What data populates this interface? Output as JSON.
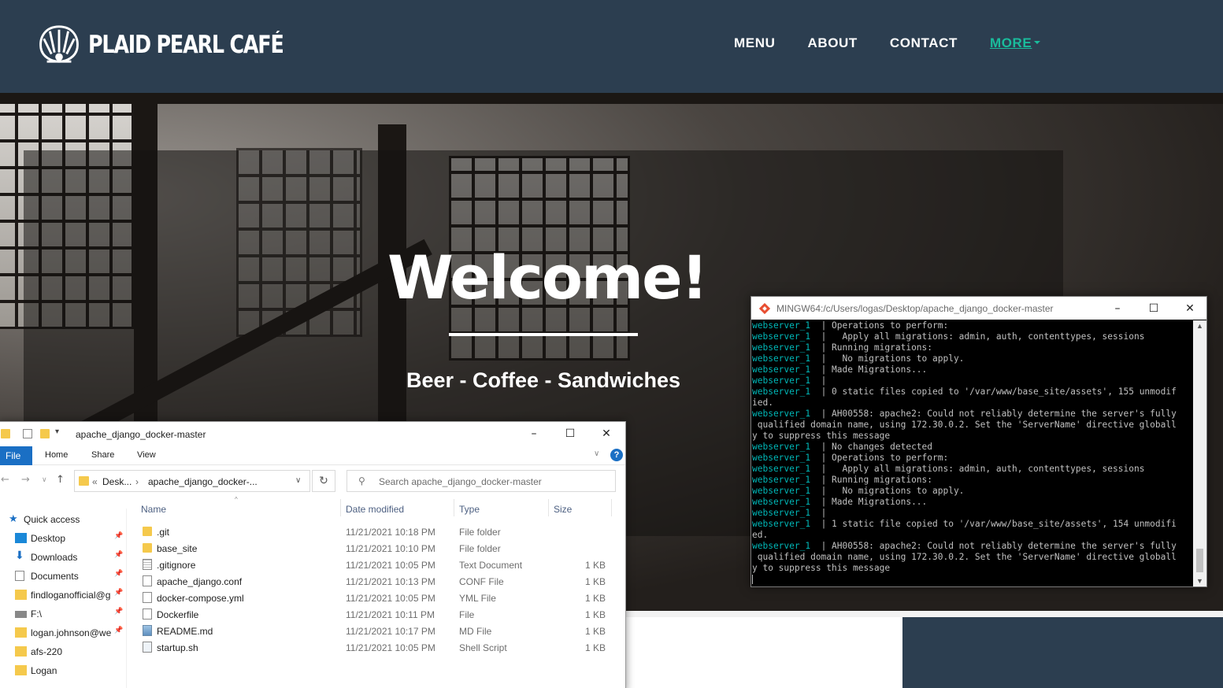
{
  "site": {
    "brand": "PLAID PEARL CAFÉ",
    "nav": [
      "MENU",
      "ABOUT",
      "CONTACT",
      "MORE"
    ],
    "hero_title": "Welcome!",
    "hero_tagline": "Beer - Coffee - Sandwiches",
    "colors": {
      "nav_bg": "#2c3e50",
      "accent": "#1abc9c"
    }
  },
  "terminal": {
    "title": "MINGW64:/c/Users/logas/Desktop/apache_django_docker-master",
    "lines": [
      {
        "prefix": "webserver_1",
        "text": "  | Operations to perform:"
      },
      {
        "prefix": "webserver_1",
        "text": "  |   Apply all migrations: admin, auth, contenttypes, sessions"
      },
      {
        "prefix": "webserver_1",
        "text": "  | Running migrations:"
      },
      {
        "prefix": "webserver_1",
        "text": "  |   No migrations to apply."
      },
      {
        "prefix": "webserver_1",
        "text": "  | Made Migrations..."
      },
      {
        "prefix": "webserver_1",
        "text": "  |"
      },
      {
        "prefix": "webserver_1",
        "text": "  | 0 static files copied to '/var/www/base_site/assets', 155 unmodif"
      },
      {
        "prefix": "",
        "text": "ied."
      },
      {
        "prefix": "webserver_1",
        "text": "  | AH00558: apache2: Could not reliably determine the server's fully"
      },
      {
        "prefix": "",
        "text": " qualified domain name, using 172.30.0.2. Set the 'ServerName' directive globall"
      },
      {
        "prefix": "",
        "text": "y to suppress this message"
      },
      {
        "prefix": "webserver_1",
        "text": "  | No changes detected"
      },
      {
        "prefix": "webserver_1",
        "text": "  | Operations to perform:"
      },
      {
        "prefix": "webserver_1",
        "text": "  |   Apply all migrations: admin, auth, contenttypes, sessions"
      },
      {
        "prefix": "webserver_1",
        "text": "  | Running migrations:"
      },
      {
        "prefix": "webserver_1",
        "text": "  |   No migrations to apply."
      },
      {
        "prefix": "webserver_1",
        "text": "  | Made Migrations..."
      },
      {
        "prefix": "webserver_1",
        "text": "  |"
      },
      {
        "prefix": "webserver_1",
        "text": "  | 1 static file copied to '/var/www/base_site/assets', 154 unmodifi"
      },
      {
        "prefix": "",
        "text": "ed."
      },
      {
        "prefix": "webserver_1",
        "text": "  | AH00558: apache2: Could not reliably determine the server's fully"
      },
      {
        "prefix": "",
        "text": " qualified domain name, using 172.30.0.2. Set the 'ServerName' directive globall"
      },
      {
        "prefix": "",
        "text": "y to suppress this message"
      }
    ]
  },
  "explorer": {
    "title": "apache_django_docker-master",
    "ribbon": [
      "File",
      "Home",
      "Share",
      "View"
    ],
    "breadcrumb": [
      "Desk...",
      "apache_django_docker-..."
    ],
    "search_placeholder": "Search apache_django_docker-master",
    "nav_items": [
      {
        "label": "Quick access",
        "icon": "star-icon",
        "pinned": false
      },
      {
        "label": "Desktop",
        "icon": "desktop-icon",
        "pinned": true
      },
      {
        "label": "Downloads",
        "icon": "download-icon",
        "pinned": true
      },
      {
        "label": "Documents",
        "icon": "documents-icon",
        "pinned": true
      },
      {
        "label": "findloganofficial@g",
        "icon": "user-folder-icon",
        "pinned": true
      },
      {
        "label": "F:\\",
        "icon": "drive-icon",
        "pinned": true
      },
      {
        "label": "logan.johnson@we",
        "icon": "user-folder-icon",
        "pinned": true
      },
      {
        "label": "afs-220",
        "icon": "folder-icon",
        "pinned": false
      },
      {
        "label": "Logan",
        "icon": "folder-icon",
        "pinned": false
      }
    ],
    "columns": [
      "Name",
      "Date modified",
      "Type",
      "Size"
    ],
    "files": [
      {
        "name": ".git",
        "date": "11/21/2021 10:18 PM",
        "type": "File folder",
        "size": "",
        "kind": "folder"
      },
      {
        "name": "base_site",
        "date": "11/21/2021 10:10 PM",
        "type": "File folder",
        "size": "",
        "kind": "folder"
      },
      {
        "name": ".gitignore",
        "date": "11/21/2021 10:05 PM",
        "type": "Text Document",
        "size": "1 KB",
        "kind": "text"
      },
      {
        "name": "apache_django.conf",
        "date": "11/21/2021 10:13 PM",
        "type": "CONF File",
        "size": "1 KB",
        "kind": "file"
      },
      {
        "name": "docker-compose.yml",
        "date": "11/21/2021 10:05 PM",
        "type": "YML File",
        "size": "1 KB",
        "kind": "file"
      },
      {
        "name": "Dockerfile",
        "date": "11/21/2021 10:11 PM",
        "type": "File",
        "size": "1 KB",
        "kind": "file"
      },
      {
        "name": "README.md",
        "date": "11/21/2021 10:17 PM",
        "type": "MD File",
        "size": "1 KB",
        "kind": "image"
      },
      {
        "name": "startup.sh",
        "date": "11/21/2021 10:05 PM",
        "type": "Shell Script",
        "size": "1 KB",
        "kind": "script"
      }
    ]
  }
}
